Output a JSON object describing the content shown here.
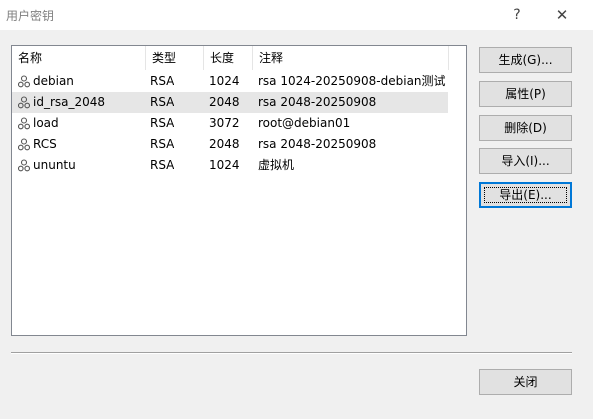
{
  "window": {
    "title": "用户密钥",
    "help_label": "?",
    "close_label": "✕"
  },
  "columns": [
    "名称",
    "类型",
    "长度",
    "注释"
  ],
  "rows": [
    {
      "name": "debian",
      "type": "RSA",
      "length": "1024",
      "comment": "rsa 1024-20250908-debian测试",
      "selected": false
    },
    {
      "name": "id_rsa_2048",
      "type": "RSA",
      "length": "2048",
      "comment": "rsa 2048-20250908",
      "selected": true
    },
    {
      "name": "load",
      "type": "RSA",
      "length": "3072",
      "comment": "root@debian01",
      "selected": false
    },
    {
      "name": "RCS",
      "type": "RSA",
      "length": "2048",
      "comment": "rsa 2048-20250908",
      "selected": false
    },
    {
      "name": "ununtu",
      "type": "RSA",
      "length": "1024",
      "comment": "虚拟机",
      "selected": false
    }
  ],
  "buttons": {
    "generate": "生成(G)...",
    "properties": "属性(P)",
    "delete": "删除(D)",
    "import": "导入(I)...",
    "export": "导出(E)...",
    "close": "关闭"
  },
  "icons": {
    "row_icon": "key-icon",
    "help": "help-icon",
    "close": "close-icon"
  },
  "colors": {
    "selected_row": "#e6e6e6",
    "default_button_border": "#0078d7"
  }
}
